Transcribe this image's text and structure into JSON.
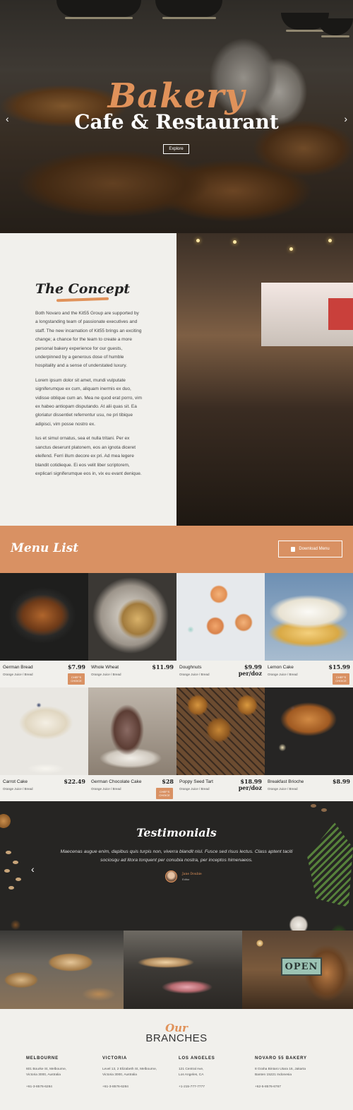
{
  "hero": {
    "title": "Bakery",
    "subtitle": "Cafe & Restaurant",
    "button_label": "Explore",
    "prev_arrow": "‹",
    "next_arrow": "›"
  },
  "concept": {
    "title": "The Concept",
    "paragraphs": [
      "Both Novaro and the Kit55 Group are supported by a longstanding team of passionate executives and staff. The new incarnation of Kit55 brings an exciting change; a chance for the team to create a more personal bakery experience for our guests, underpinned by a generous dose of humble hospitality and a sense of understated luxury.",
      "Lorem ipsum dolor sit amet, mundi vulputate signiferumque ex cum, aliquam inermis ex duo, vidisse oblique cum an. Mea ne quod erat porro, vim ex habeo antiopam disputando. At alii quas sit. Ea gloriatur dissentiet referrentur usu, ne pri tibique adipisci, vim posse nostro ex.",
      "Ius et simul ornatus, sea et nulla tritani. Per ex sanctus deserunt platonem, eos an ignota diceret eleifend. Ferri illum decore ex pri. Ad mea legere blandit cotidieque. Ei eos velit liber scriptorem, explicari signiferumque eos in, vix eu evant denique."
    ]
  },
  "menu": {
    "title": "Menu List",
    "download_label": "Download Menu",
    "items": [
      {
        "name": "German Bread",
        "sub": "Orange Juice / Bread",
        "price": "$7.99",
        "price2": "",
        "badge": "CHEF'S CHOICE"
      },
      {
        "name": "Whole Wheat",
        "sub": "Orange Juice / Bread",
        "price": "$11.99",
        "price2": "",
        "badge": ""
      },
      {
        "name": "Doughnuts",
        "sub": "Orange Juice / Bread",
        "price": "$9.99",
        "price2": "per/doz",
        "badge": ""
      },
      {
        "name": "Lemon Cake",
        "sub": "Orange Juice / Bread",
        "price": "$15.99",
        "price2": "",
        "badge": "CHEF'S CHOICE"
      },
      {
        "name": "Carrot Cake",
        "sub": "Orange Juice / Bread",
        "price": "$22.49",
        "price2": "",
        "badge": ""
      },
      {
        "name": "German Chocolate Cake",
        "sub": "Orange Juice / Bread",
        "price": "$28",
        "price2": "",
        "badge": "CHEF'S CHOICE"
      },
      {
        "name": "Poppy Seed Tart",
        "sub": "Orange Juice / Bread",
        "price": "$18.99",
        "price2": "per/doz",
        "badge": ""
      },
      {
        "name": "Breakfast Brioche",
        "sub": "Orange Juice / Bread",
        "price": "$8.99",
        "price2": "",
        "badge": ""
      }
    ]
  },
  "testimonials": {
    "title": "Testimonials",
    "quote": "Maecenas augue enim, dapibus quis turpis non, viverra blandit nisl. Fusce sed risus lectus. Class aptent taciti sociosqu ad litora torquent per conubia nostra, per inceptos himenaeos.",
    "author": "Jane Doubie",
    "role": "Editor",
    "prev_arrow": "‹"
  },
  "gallery": {
    "open_sign": "OPEN"
  },
  "branches": {
    "title_top": "Our",
    "title_bottom": "BRANCHES",
    "columns": [
      {
        "city": "MELBOURNE",
        "address1": "601 Bourke St, Melbourne,",
        "address2": "Victoria 3000, Australia",
        "phone": "+61-3-8576-6284"
      },
      {
        "city": "VICTORIA",
        "address1": "Level 13, 2 Elizabeth St, Melbourne,",
        "address2": "Victoria 3000, Australia",
        "phone": "+61-3-8576-6284"
      },
      {
        "city": "LOS ANGELES",
        "address1": "121 Central Ave,",
        "address2": "Los Angeles, CA",
        "phone": "+1-215-777-7777"
      },
      {
        "city": "NOVARO 55 BAKERY",
        "address1": "8 Graha Bintaro Utara 16, Jakarta",
        "address2": "Banten 15221 Indonesia",
        "phone": "+62-5-8576-6767"
      }
    ]
  },
  "colors": {
    "accent": "#d99163",
    "heading_accent": "#e0925a",
    "dark": "#262523",
    "background": "#f1f0ec"
  }
}
